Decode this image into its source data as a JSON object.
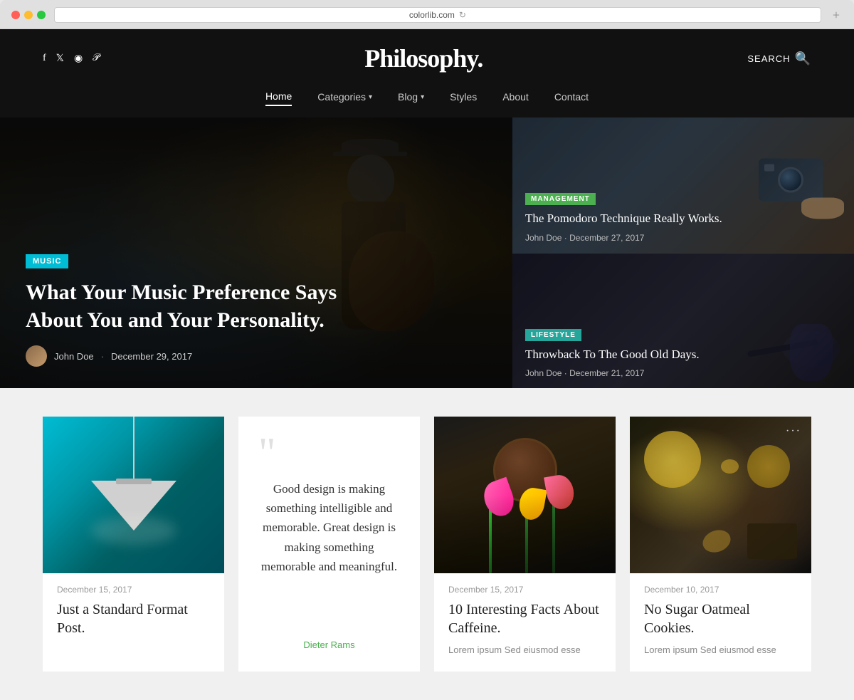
{
  "browser": {
    "url": "colorlib.com",
    "new_tab_label": "+"
  },
  "site": {
    "title": "Philosophy.",
    "search_label": "SEARCH"
  },
  "social": {
    "facebook": "f",
    "twitter": "𝕏",
    "instagram": "◎",
    "pinterest": "𝒫"
  },
  "nav": {
    "items": [
      {
        "label": "Home",
        "active": true,
        "has_dropdown": false
      },
      {
        "label": "Categories",
        "active": false,
        "has_dropdown": true
      },
      {
        "label": "Blog",
        "active": false,
        "has_dropdown": true
      },
      {
        "label": "Styles",
        "active": false,
        "has_dropdown": false
      },
      {
        "label": "About",
        "active": false,
        "has_dropdown": false
      },
      {
        "label": "Contact",
        "active": false,
        "has_dropdown": false
      }
    ]
  },
  "hero": {
    "category": "MUSIC",
    "title": "What Your Music Preference Says About You and Your Personality.",
    "author": "John Doe",
    "date": "December 29, 2017",
    "dot": "·"
  },
  "side_card_1": {
    "badge": "MANAGEMENT",
    "title": "The Pomodoro Technique Really Works.",
    "author": "John Doe",
    "date": "December 27, 2017",
    "dot": "·"
  },
  "side_card_2": {
    "badge": "LIFESTYLE",
    "title": "Throwback To The Good Old Days.",
    "author": "John Doe",
    "date": "December 21, 2017",
    "dot": "·"
  },
  "cards": [
    {
      "type": "image",
      "date": "December 15, 2017",
      "title": "Just a Standard Format Post.",
      "excerpt": ""
    },
    {
      "type": "quote",
      "quote_text": "Good design is making something intelligible and memorable. Great design is making something memorable and meaningful.",
      "author": "Dieter Rams"
    },
    {
      "type": "image",
      "date": "December 15, 2017",
      "title": "10 Interesting Facts About Caffeine.",
      "excerpt": "Lorem ipsum Sed eiusmod esse"
    },
    {
      "type": "image",
      "date": "December 10, 2017",
      "title": "No Sugar Oatmeal Cookies.",
      "excerpt": "Lorem ipsum Sed eiusmod esse"
    }
  ]
}
